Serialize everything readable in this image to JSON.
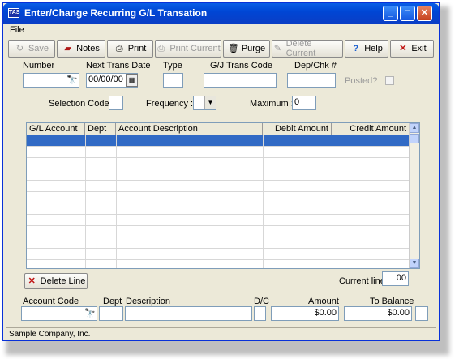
{
  "window": {
    "title": "Enter/Change Recurring G/L Transation",
    "app_icon_text": "TAS"
  },
  "menu": {
    "file": "File"
  },
  "toolbar": {
    "save": "Save",
    "notes": "Notes",
    "print": "Print",
    "print_current": "Print Current",
    "purge": "Purge",
    "delete_current": "Delete Current",
    "help": "Help",
    "exit": "Exit"
  },
  "header_fields": {
    "number_label": "Number",
    "number_value": "",
    "next_trans_date_label": "Next Trans Date",
    "next_trans_date_value": "00/00/00",
    "type_label": "Type",
    "type_value": "",
    "gj_trans_code_label": "G/J Trans Code",
    "gj_trans_code_value": "",
    "dep_chk_label": "Dep/Chk #",
    "dep_chk_value": "",
    "posted_label": "Posted?",
    "selection_code_label": "Selection Code :",
    "frequency_label": "Frequency :",
    "maximum_label": "Maximum :",
    "maximum_value": "0"
  },
  "grid": {
    "columns": [
      "G/L Account",
      "Dept",
      "Account Description",
      "Debit Amount",
      "Credit Amount"
    ]
  },
  "line_controls": {
    "delete_line": "Delete Line",
    "current_line_label": "Current line",
    "current_line_value": "00"
  },
  "entry": {
    "account_code_label": "Account Code",
    "dept_label": "Dept",
    "description_label": "Description",
    "dc_label": "D/C",
    "amount_label": "Amount",
    "to_balance_label": "To Balance",
    "amount_value": "$0.00",
    "to_balance_value": "$0.00"
  },
  "status": {
    "company": "Sample Company, Inc."
  }
}
